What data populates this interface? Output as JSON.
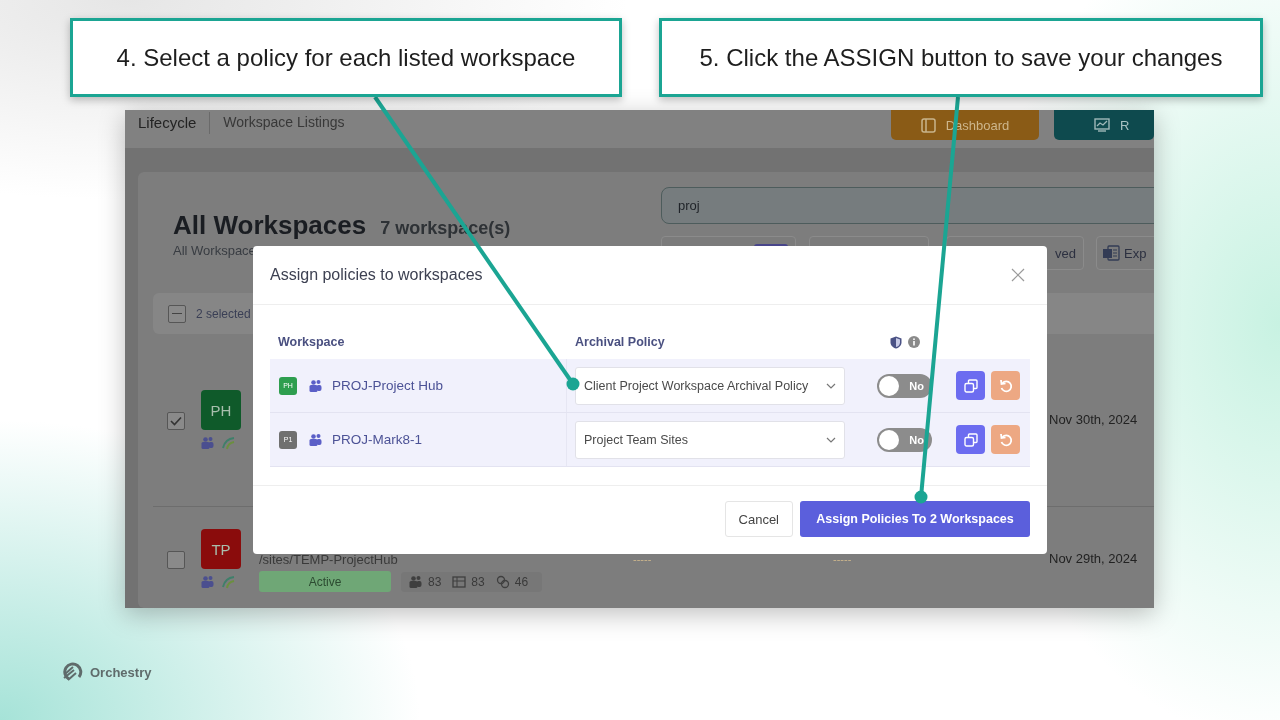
{
  "callouts": [
    {
      "text": "4. Select a policy for each listed workspace"
    },
    {
      "text": "5. Click the ASSIGN button to save your changes"
    }
  ],
  "app": {
    "breadcrumb": [
      "Lifecycle",
      "Workspace Listings"
    ],
    "header_buttons": [
      {
        "kind": "dashboard",
        "label": "Dashboard"
      },
      {
        "kind": "reports",
        "label": "R"
      }
    ],
    "title": "All Workspaces",
    "count": "7 workspace(s)",
    "subtitle": "All Workspace",
    "search": {
      "value": "proj"
    },
    "filters": [
      {
        "kind": "badge"
      },
      {
        "kind": "plain"
      },
      {
        "kind": "text",
        "label": "ved"
      },
      {
        "kind": "export",
        "label": "Exp"
      }
    ],
    "selection": {
      "label": "2 selected",
      "indeterminate": true
    },
    "rows": [
      {
        "checked": true,
        "initials": "PH",
        "color": "#0f5a2a",
        "date": "Nov 30th, 2024"
      },
      {
        "checked": false,
        "initials": "TP",
        "color": "#8a0c0c",
        "path": "/sites/TEMP-ProjectHub",
        "status": "Active",
        "counts": [
          "83",
          "83",
          "46"
        ],
        "column_4": "-----",
        "column_5": "-----",
        "date": "Nov 29th, 2024"
      }
    ]
  },
  "dialog": {
    "title": "Assign policies to workspaces",
    "columns": [
      "Workspace",
      "Archival Policy"
    ],
    "rows": [
      {
        "initials": "PH",
        "color": "#2e9e4f",
        "name": "PROJ-Project Hub",
        "policy": "Client Project Workspace Archival Policy",
        "on": false,
        "toggle_label": "No"
      },
      {
        "initials": "P1",
        "color": "#707070",
        "name": "PROJ-Mark8-1",
        "policy": "Project Team Sites",
        "on": false,
        "toggle_label": "No"
      }
    ],
    "buttons": [
      {
        "kind": "secondary",
        "label": "Cancel"
      },
      {
        "kind": "primary",
        "label": "Assign Policies To 2 Workspaces"
      }
    ]
  },
  "logo": {
    "text": "Orchestry"
  }
}
